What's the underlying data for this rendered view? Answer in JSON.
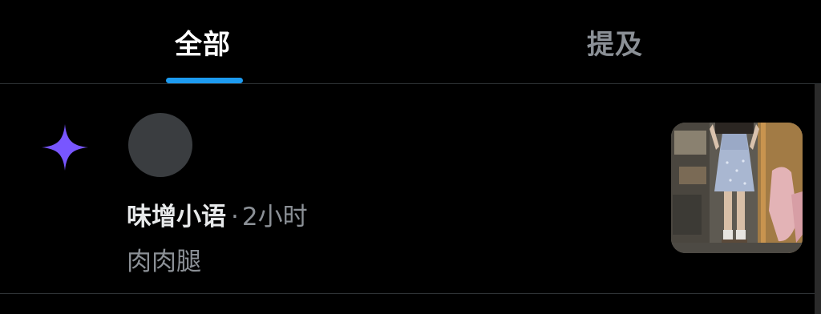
{
  "tabs": [
    {
      "label": "全部",
      "active": true
    },
    {
      "label": "提及",
      "active": false
    }
  ],
  "accent_color": "#1d9bf0",
  "notification": {
    "icon": "sparkle-icon",
    "icon_color": "#7856ff",
    "user_name": "味增小语",
    "separator": "·",
    "time": "2小时",
    "text": "肉肉腿"
  }
}
